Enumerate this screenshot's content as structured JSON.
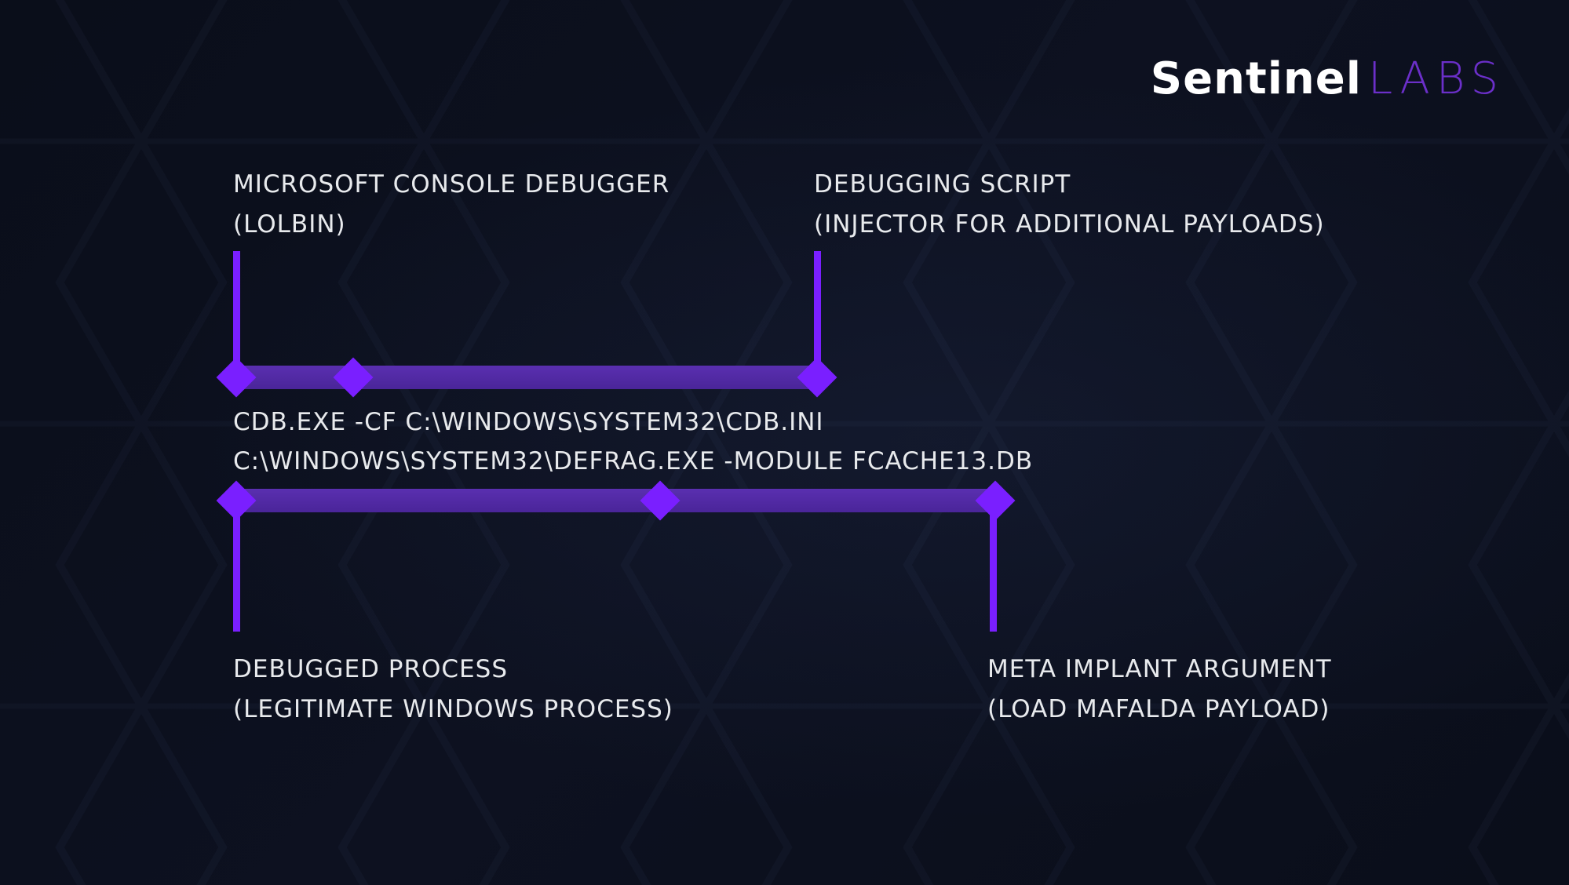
{
  "brand": {
    "part1": "Sentinel",
    "part2": "LABS"
  },
  "labels": {
    "top_left": {
      "line1": "MICROSOFT CONSOLE DEBUGGER",
      "line2": "(LOLBIN)"
    },
    "top_right": {
      "line1": "DEBUGGING SCRIPT",
      "line2": "(INJECTOR FOR ADDITIONAL PAYLOADS)"
    },
    "bottom_left": {
      "line1": "DEBUGGED PROCESS",
      "line2": "(LEGITIMATE WINDOWS PROCESS)"
    },
    "bottom_right": {
      "line1": "META IMPLANT ARGUMENT",
      "line2": "(LOAD MAFALDA PAYLOAD)"
    }
  },
  "command": {
    "line1": "CDB.EXE -CF C:\\WINDOWS\\SYSTEM32\\CDB.INI",
    "line2": "C:\\WINDOWS\\SYSTEM32\\DEFRAG.EXE -MODULE FCACHE13.DB"
  },
  "colors": {
    "accent": "#7a1fff",
    "bar": "#4a2599",
    "text": "#e8eaed"
  }
}
